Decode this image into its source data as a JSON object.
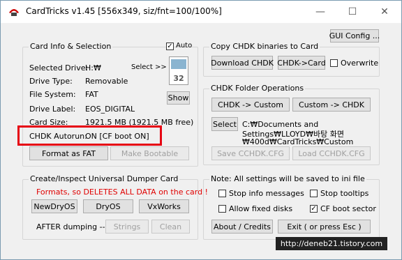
{
  "window": {
    "title": "CardTricks v1.45 [556x349, siz/fnt=100/100%]"
  },
  "controls": {
    "min": "—",
    "max": "☐",
    "close": "✕"
  },
  "gui_config_button": "GUI Config ...",
  "card_info": {
    "group_title": "Card Info & Selection",
    "auto_label": "Auto",
    "select_label": "Select >>",
    "card_number": "32",
    "show_button": "Show",
    "rows": [
      {
        "label": "Selected Drive:",
        "value": "H:₩"
      },
      {
        "label": "Drive Type:",
        "value": "Removable"
      },
      {
        "label": "File System:",
        "value": "FAT"
      },
      {
        "label": "Drive Label:",
        "value": "EOS_DIGITAL"
      },
      {
        "label": "Card Size:",
        "value": "1921.5 MB  (1921.5 MB free)"
      },
      {
        "label": "CHDK Autorun:",
        "value": "ON [CF boot ON]"
      }
    ],
    "format_button": "Format as FAT",
    "bootable_button": "Make Bootable"
  },
  "copy_chdk": {
    "group_title": "Copy CHDK binaries to Card",
    "download_button": "Download CHDK",
    "to_card_button": "CHDK->Card",
    "overwrite_label": "Overwrite"
  },
  "folder_ops": {
    "group_title": "CHDK Folder Operations",
    "chdk_to_custom": "CHDK -> Custom",
    "custom_to_chdk": "Custom -> CHDK",
    "select_button": "Select",
    "path_lines": [
      "C:₩Documents and",
      "Settings₩LLOYD₩바탕 화면",
      "₩400d₩CardTricks₩Custom"
    ],
    "save_button": "Save CCHDK.CFG",
    "load_button": "Load CCHDK.CFG"
  },
  "dumper": {
    "group_title": "Create/Inspect Universal Dumper Card",
    "warning": "Formats, so DELETES ALL DATA on the card !",
    "newdryos": "NewDryOS",
    "dryos": "DryOS",
    "vxworks": "VxWorks",
    "after_label": "AFTER dumping -->",
    "strings": "Strings",
    "clean": "Clean"
  },
  "settings": {
    "group_title": "Note: All settings will be saved to ini file",
    "stop_info": "Stop info messages",
    "stop_tooltips": "Stop tooltips",
    "allow_fixed": "Allow fixed disks",
    "cf_boot": "CF boot sector",
    "about_button": "About / Credits",
    "exit_button": "Exit ( or press Esc )"
  },
  "checkbox_states": {
    "auto": true,
    "overwrite": false,
    "stop_info": false,
    "stop_tooltips": false,
    "allow_fixed": false,
    "cf_boot": true
  },
  "watermark": "http://deneb21.tistory.com",
  "colors": {
    "warning": "#e00000",
    "highlight_border": "#e60012"
  }
}
